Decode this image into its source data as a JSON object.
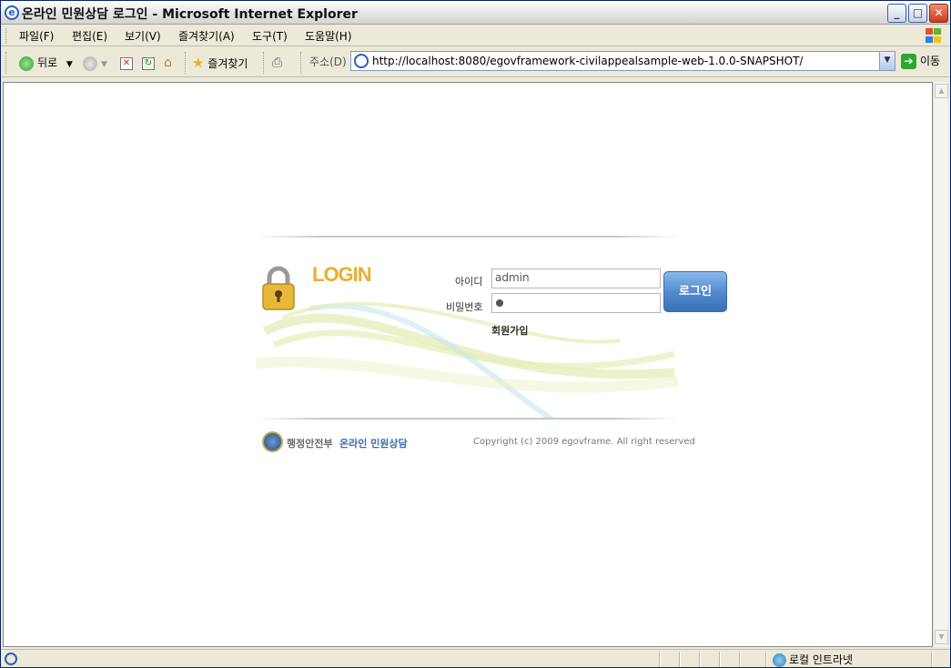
{
  "window": {
    "title": "온라인 민원상담 로그인 - Microsoft Internet Explorer",
    "controls": {
      "minimize": "_",
      "maximize": "□",
      "close": "✕"
    }
  },
  "menubar": {
    "items": [
      "파일(F)",
      "편집(E)",
      "보기(V)",
      "즐겨찾기(A)",
      "도구(T)",
      "도움말(H)"
    ]
  },
  "toolbar": {
    "back_label": "뒤로",
    "favorites_label": "즐겨찾기",
    "address_label": "주소(D)",
    "address_url": "http://localhost:8080/egovframework-civilappealsample-web-1.0.0-SNAPSHOT/",
    "go_label": "이동"
  },
  "login": {
    "heading": "LOGIN",
    "id_label": "아이디",
    "id_value": "admin",
    "password_label": "비밀번호",
    "submit_label": "로그인",
    "join_label": "회원가입"
  },
  "footer": {
    "ministry": "행정안전부",
    "service": "온라인 민원상담",
    "copyright": "Copyright (c) 2009 egovframe. All right reserved"
  },
  "statusbar": {
    "zone": "로컬 인트라넷"
  },
  "colors": {
    "login_heading": "#e8b030",
    "login_button": "#4f88cc",
    "service_text": "#3b6eb4"
  }
}
